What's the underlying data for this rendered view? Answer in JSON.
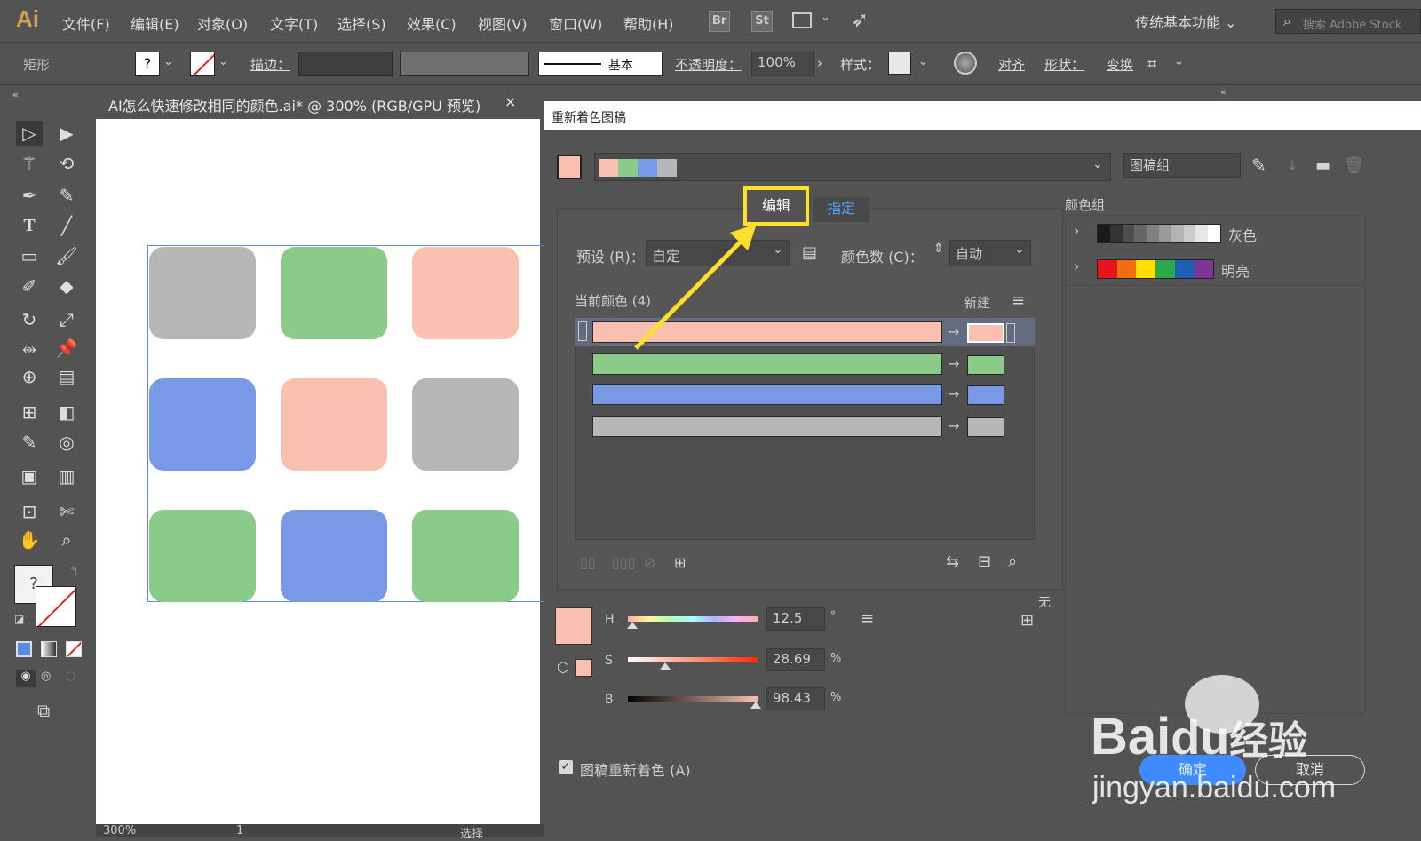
{
  "app": {
    "logo": "Ai"
  },
  "menu": [
    "文件(F)",
    "编辑(E)",
    "对象(O)",
    "文字(T)",
    "选择(S)",
    "效果(C)",
    "视图(V)",
    "窗口(W)",
    "帮助(H)"
  ],
  "menubar_icons": {
    "br": "Br",
    "st": "St"
  },
  "workspace": "传统基本功能",
  "search_placeholder": "搜索 Adobe Stock",
  "control": {
    "object_type": "矩形",
    "stroke_label": "描边：",
    "stroke_style": "基本",
    "opacity_label": "不透明度：",
    "opacity_value": "100%",
    "style_label": "样式：",
    "align": "对齐",
    "shape": "形状：",
    "transform": "变换"
  },
  "document_tab": {
    "title": "AI怎么快速修改相同的颜色.ai* @ 300% (RGB/GPU 预览)",
    "close": "×"
  },
  "canvas": {
    "tiles": [
      "#b7b7b7",
      "#8acb88",
      "#f9c0b0",
      "#7799e6",
      "#f9c0b0",
      "#b7b7b7",
      "#8acb88",
      "#7799e6",
      "#8acb88"
    ]
  },
  "status": {
    "zoom": "300%",
    "page": "1",
    "tool": "选择"
  },
  "dialog": {
    "title": "重新着色图稿",
    "artwork_group": "图稿组",
    "harmony_colors": [
      "#f9c0b0",
      "#8acb88",
      "#7799e6",
      "#b7b7b7"
    ],
    "tabs": {
      "edit": "编辑",
      "assign": "指定"
    },
    "preset_label": "预设 (R)：",
    "preset_value": "自定",
    "colors_label": "颜色数 (C)：",
    "colors_value": "自动",
    "current_colors_label": "当前颜色 (4)",
    "new_label": "新建",
    "color_rows": [
      "#f9c0b0",
      "#8acb88",
      "#7799e6",
      "#b7b7b7"
    ],
    "none_label": "无",
    "hsb": {
      "h_label": "H",
      "h_value": "12.5",
      "h_unit": "°",
      "s_label": "S",
      "s_value": "28.69",
      "s_unit": "%",
      "b_label": "B",
      "b_value": "98.43",
      "b_unit": "%",
      "h_level": 0.035,
      "s_level": 0.287,
      "b_level": 0.984
    },
    "recolor_checkbox": "图稿重新着色 (A)",
    "ok_button": "确定",
    "cancel_button": "取消",
    "color_groups_label": "颜色组",
    "groups": [
      {
        "name": "灰色",
        "swatches": [
          "#1a1a1a",
          "#333333",
          "#4d4d4d",
          "#666666",
          "#808080",
          "#999999",
          "#b3b3b3",
          "#cccccc",
          "#e6e6e6",
          "#ffffff"
        ]
      },
      {
        "name": "明亮",
        "swatches": [
          "#e8141b",
          "#f06d13",
          "#ffde00",
          "#2aa84a",
          "#1d5fb5",
          "#7d3596"
        ]
      }
    ]
  },
  "watermark": {
    "brand": "Bai",
    "brand2": "du",
    "cn": "经验",
    "url": "jingyan.baidu.com"
  },
  "colors": {
    "highlight": "#ffe02a",
    "ui_bg": "#535353"
  }
}
